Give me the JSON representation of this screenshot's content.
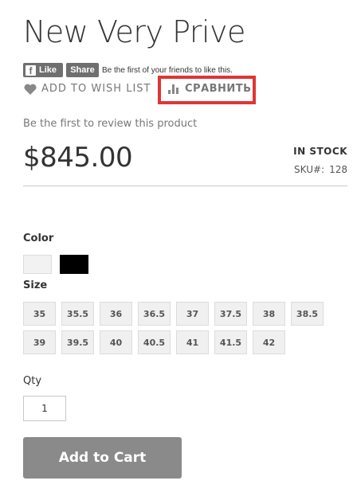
{
  "product": {
    "title": "New Very Prive",
    "price": "$845.00",
    "stock": "IN STOCK",
    "sku_label": "SKU#:",
    "sku_value": "128"
  },
  "social": {
    "like_label": "Like",
    "share_label": "Share",
    "friends_text": "Be the first of your friends to like this."
  },
  "actions": {
    "wishlist_label": "ADD TO WISH LIST",
    "compare_label": "СРАВНИТЬ",
    "highlight_color": "#e03535"
  },
  "review_text": "Be the first to review this product",
  "options": {
    "color_label": "Color",
    "colors": [
      "#f2f2f2",
      "#000000"
    ],
    "size_label": "Size",
    "sizes": [
      "35",
      "35.5",
      "36",
      "36.5",
      "37",
      "37.5",
      "38",
      "38.5",
      "39",
      "39.5",
      "40",
      "40.5",
      "41",
      "41.5",
      "42"
    ]
  },
  "qty": {
    "label": "Qty",
    "value": "1"
  },
  "cart": {
    "button_label": "Add to Cart",
    "button_color": "#8a8a8a"
  }
}
